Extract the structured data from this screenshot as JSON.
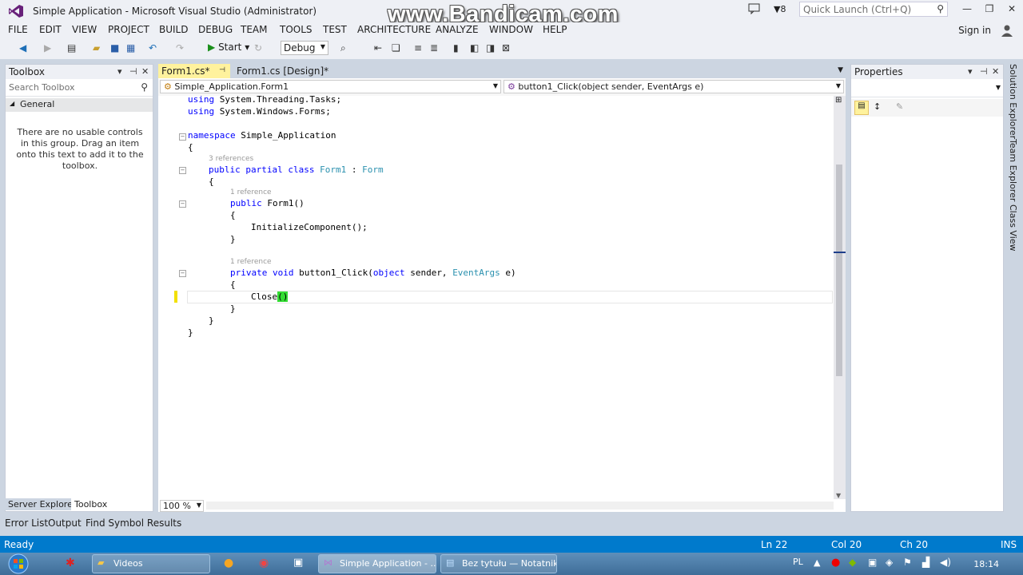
{
  "window": {
    "title": "Simple Application - Microsoft Visual Studio (Administrator)",
    "watermark": "www.Bandicam.com",
    "notification_count": "8",
    "quick_launch_placeholder": "Quick Launch (Ctrl+Q)",
    "sign_in": "Sign in"
  },
  "menu": [
    "FILE",
    "EDIT",
    "VIEW",
    "PROJECT",
    "BUILD",
    "DEBUG",
    "TEAM",
    "TOOLS",
    "TEST",
    "ARCHITECTURE",
    "ANALYZE",
    "WINDOW",
    "HELP"
  ],
  "toolbar": {
    "start_label": "Start",
    "config_value": "Debug"
  },
  "toolbox": {
    "title": "Toolbox",
    "search_placeholder": "Search Toolbox",
    "group": "General",
    "empty_message": "There are no usable controls in this group. Drag an item onto this text to add it to the toolbox.",
    "tabs": [
      "Server Explorer",
      "Toolbox"
    ]
  },
  "editor": {
    "tabs": [
      "Form1.cs*",
      "Form1.cs [Design]*"
    ],
    "nav_left": "Simple_Application.Form1",
    "nav_right": "button1_Click(object sender, EventArgs e)",
    "zoom": "100 %",
    "references": {
      "r3": "3 references",
      "r1a": "1 reference",
      "r1b": "1 reference"
    },
    "lines": {
      "l1_kw": "using",
      "l1_rest": " System.Threading.Tasks;",
      "l2_kw": "using",
      "l2_rest": " System.Windows.Forms;",
      "l3_kw": "namespace",
      "l3_rest": " Simple_Application",
      "l4": "{",
      "l5_kw": "public partial class",
      "l5_ty1": " Form1",
      "l5_sep": " : ",
      "l5_ty2": "Form",
      "l6": "{",
      "l7_kw": "public",
      "l7_rest": " Form1()",
      "l8": "{",
      "l9": "InitializeComponent();",
      "l10": "}",
      "l11_kw": "private void",
      "l11_a": " button1_Click(",
      "l11_kw2": "object",
      "l11_b": " sender, ",
      "l11_ty": "EventArgs",
      "l11_c": " e)",
      "l12": "{",
      "l13_a": "Close",
      "l13_b": "()",
      "l14": "}",
      "l15": "}",
      "l16": "}"
    }
  },
  "properties": {
    "title": "Properties"
  },
  "side_tabs": [
    "Solution Explorer",
    "Team Explorer",
    "Class View"
  ],
  "bottom_tabs": [
    "Error List",
    "Output",
    "Find Symbol Results"
  ],
  "status": {
    "state": "Ready",
    "ln": "Ln 22",
    "col": "Col 20",
    "ch": "Ch 20",
    "mode": "INS"
  },
  "taskbar": {
    "items": [
      "Videos",
      "Simple Application - ...",
      "Bez tytułu — Notatnik"
    ],
    "lang": "PL",
    "time": "18:14"
  },
  "colors": {
    "accent": "#007acc",
    "keyword": "#0000ff",
    "type": "#2b91af",
    "brace_highlight": "#33dd33"
  }
}
